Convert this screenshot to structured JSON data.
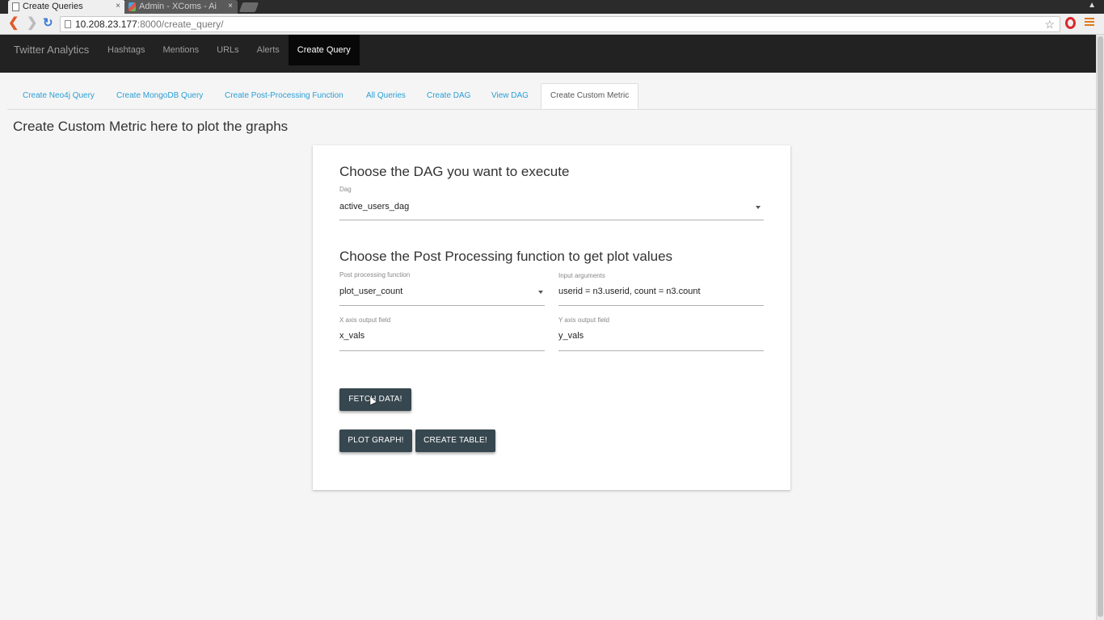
{
  "browser": {
    "tabs": [
      {
        "title": "Create Queries",
        "active": true
      },
      {
        "title": "Admin - XComs - Ai",
        "active": false
      }
    ],
    "close_glyph": "×",
    "url_host": "10.208.23.177",
    "url_rest": ":8000/create_query/",
    "icons": [
      "back-icon",
      "forward-icon",
      "reload-icon",
      "page-icon",
      "star-icon",
      "opera-icon",
      "menu-icon"
    ]
  },
  "app": {
    "brand": "Twitter Analytics",
    "nav": [
      {
        "label": "Hashtags",
        "active": false
      },
      {
        "label": "Mentions",
        "active": false
      },
      {
        "label": "URLs",
        "active": false
      },
      {
        "label": "Alerts",
        "active": false
      },
      {
        "label": "Create Query",
        "active": true
      }
    ]
  },
  "subtabs": [
    {
      "label": "Create Neo4j Query",
      "active": false
    },
    {
      "label": "Create MongoDB Query",
      "active": false
    },
    {
      "label": "Create Post-Processing Function",
      "active": false
    },
    {
      "label": "All Queries",
      "active": false
    },
    {
      "label": "Create DAG",
      "active": false
    },
    {
      "label": "View DAG",
      "active": false
    },
    {
      "label": "Create Custom Metric",
      "active": true
    }
  ],
  "page_title": "Create Custom Metric here to plot the graphs",
  "form": {
    "dag_heading": "Choose the DAG you want to execute",
    "dag_label": "Dag",
    "dag_value": "active_users_dag",
    "post_heading": "Choose the Post Processing function to get plot values",
    "ppf_label": "Post processing function",
    "ppf_value": "plot_user_count",
    "args_label": "Input arguments",
    "args_value": "userid = n3.userid, count = n3.count",
    "x_label": "X axis output field",
    "x_value": "x_vals",
    "y_label": "Y axis output field",
    "y_value": "y_vals",
    "fetch_button": "FETCH DATA!",
    "plot_button": "PLOT GRAPH!",
    "table_button": "CREATE TABLE!"
  },
  "colors": {
    "navbar": "#222222",
    "link": "#2a9fd6",
    "button": "#37474f"
  }
}
